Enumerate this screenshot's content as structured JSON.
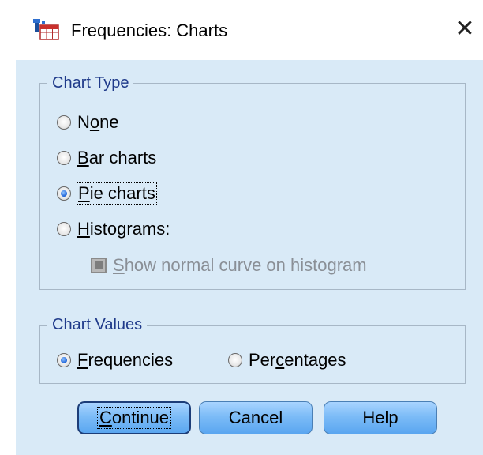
{
  "window": {
    "title": "Frequencies: Charts",
    "close_label": "✕",
    "app_icon": "spss-table-icon"
  },
  "chart_type": {
    "legend": "Chart Type",
    "options": [
      {
        "label": "None",
        "mnemonic_index": 1,
        "checked": false
      },
      {
        "label": "Bar charts",
        "mnemonic_index": 0,
        "checked": false
      },
      {
        "label": "Pie charts",
        "mnemonic_index": 0,
        "checked": true
      },
      {
        "label": "Histograms:",
        "mnemonic_index": 0,
        "checked": false
      }
    ],
    "normal_curve": {
      "label": "Show normal curve on histogram",
      "enabled": false
    }
  },
  "chart_values": {
    "legend": "Chart Values",
    "options": [
      {
        "label": "Frequencies",
        "checked": true
      },
      {
        "label": "Percentages",
        "checked": false
      }
    ]
  },
  "buttons": {
    "continue": "Continue",
    "cancel": "Cancel",
    "help": "Help"
  },
  "colors": {
    "dialog_bg": "#d9eaf7",
    "legend_text": "#1f3a8a",
    "button_fill": "#7cbcf7"
  }
}
